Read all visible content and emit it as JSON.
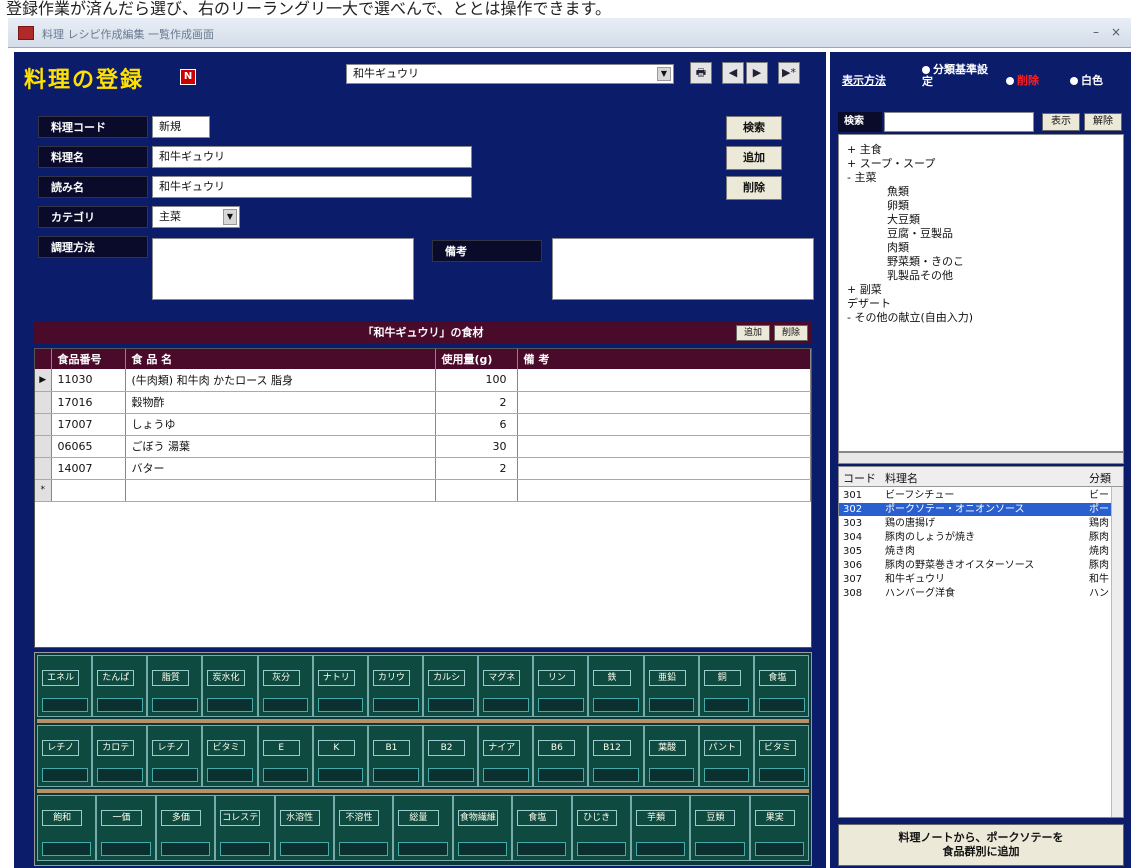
{
  "caption": "登録作業が済んだら選び、右のリーラングリ一大で選べんで、ととは操作できます。",
  "window": {
    "title": "料理 レシピ作成編集 一覧作成画面"
  },
  "header": {
    "title": "料理の登録",
    "title_badge": "N",
    "recipe_select": "和牛ギュウリ",
    "btn_print": "🖶",
    "btn_prev": "◀",
    "btn_next": "▶",
    "btn_new": "▶*"
  },
  "form": {
    "code_label": "料理コード",
    "code_value": "新規",
    "name_label": "料理名",
    "name_value": "和牛ギュウリ",
    "kana_label": "読み名",
    "kana_value": "和牛ギュウリ",
    "category_label": "カテゴリ",
    "category_value": "主菜",
    "howto_label": "調理方法",
    "note_label": "備考",
    "btn_search": "検索",
    "btn_add": "追加",
    "btn_delete": "削除"
  },
  "ingredients": {
    "bar_title": "「和牛ギュウリ」の食材",
    "btn_a": "追加",
    "btn_b": "削除",
    "columns": [
      "食品番号",
      "食 品 名",
      "使用量(g)",
      "備 考"
    ],
    "rows": [
      {
        "id": "11030",
        "name": "(牛肉類) 和牛肉 かたロース 脂身",
        "qty": "100",
        "note": ""
      },
      {
        "id": "17016",
        "name": "穀物酢",
        "qty": "2",
        "note": ""
      },
      {
        "id": "17007",
        "name": "しょうゆ",
        "qty": "6",
        "note": ""
      },
      {
        "id": "06065",
        "name": "ごぼう 湯葉",
        "qty": "30",
        "note": ""
      },
      {
        "id": "14007",
        "name": "バター",
        "qty": "2",
        "note": ""
      }
    ]
  },
  "nutrients": {
    "row1": [
      "エネルギー",
      "たんぱく",
      "脂質",
      "炭水化物",
      "灰分",
      "ナトリウム",
      "カリウム",
      "カルシウム",
      "マグネシウム",
      "リン",
      "鉄",
      "亜鉛",
      "銅",
      "食塩"
    ],
    "row2": [
      "レチノール",
      "カロテン",
      "レチノール当量",
      "ビタミンD",
      "E",
      "K",
      "B1",
      "B2",
      "ナイアシン",
      "B6",
      "B12",
      "葉酸",
      "パントテン酸",
      "ビタミンC"
    ],
    "row3": [
      "飽和",
      "一価",
      "多価",
      "コレステロール",
      "水溶性",
      "不溶性",
      "総量",
      "食物繊維",
      "食塩",
      "ひじき",
      "芋類",
      "豆類",
      "果実"
    ]
  },
  "right": {
    "link_display": "表示方法",
    "link_settings": "分類基準設定",
    "link_red": "削除",
    "link_white": "白色",
    "search_label": "検索",
    "btn_search1": "表示",
    "btn_search2": "解除",
    "tree": [
      {
        "t": "+ 主食",
        "d": 0
      },
      {
        "t": "+ スープ・スープ",
        "d": 0
      },
      {
        "t": "- 主菜",
        "d": 0
      },
      {
        "t": "魚類",
        "d": 1
      },
      {
        "t": "卵類",
        "d": 1
      },
      {
        "t": "大豆類",
        "d": 1
      },
      {
        "t": "豆腐・豆製品",
        "d": 1
      },
      {
        "t": "肉類",
        "d": 1
      },
      {
        "t": "野菜類・きのこ",
        "d": 1
      },
      {
        "t": "乳製品その他",
        "d": 1
      },
      {
        "t": "+ 副菜",
        "d": 0
      },
      {
        "t": "デザート",
        "d": 0
      },
      {
        "t": "- その他の献立(自由入力)",
        "d": 0
      }
    ],
    "list_cols": [
      "コード",
      "料理名",
      "分類"
    ],
    "list_rows": [
      {
        "c": "301",
        "n": "ビーフシチュー",
        "k": "ビー"
      },
      {
        "c": "302",
        "n": "ポークソテー・オニオンソース",
        "k": "ポー",
        "hl": true
      },
      {
        "c": "303",
        "n": "鶏の唐揚げ",
        "k": "鶏肉"
      },
      {
        "c": "304",
        "n": "豚肉のしょうが焼き",
        "k": "豚肉"
      },
      {
        "c": "305",
        "n": "焼き肉",
        "k": "焼肉"
      },
      {
        "c": "306",
        "n": "豚肉の野菜巻きオイスターソース",
        "k": "豚肉"
      },
      {
        "c": "307",
        "n": "和牛ギュウリ",
        "k": "和牛"
      },
      {
        "c": "308",
        "n": "ハンバーグ洋食",
        "k": "ハン"
      }
    ],
    "bottom_btn_line1": "料理ノートから、ポークソテーを",
    "bottom_btn_line2": "食品群別に追加"
  }
}
